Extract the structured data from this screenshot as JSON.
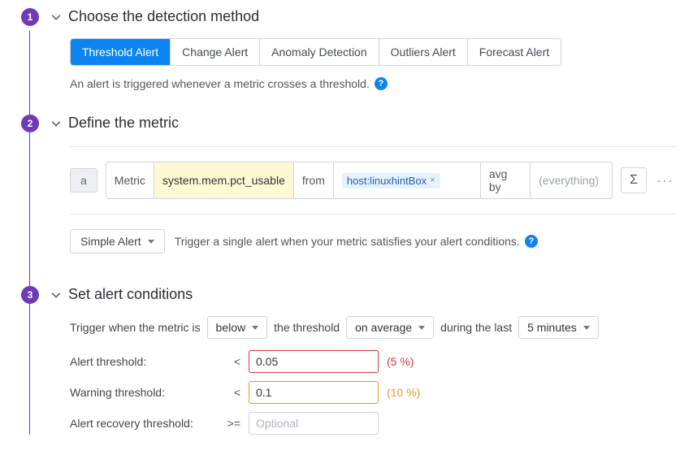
{
  "step1": {
    "num": "1",
    "title": "Choose the detection method",
    "tabs": [
      "Threshold Alert",
      "Change Alert",
      "Anomaly Detection",
      "Outliers Alert",
      "Forecast Alert"
    ],
    "activeTab": 0,
    "desc": "An alert is triggered whenever a metric crosses a threshold.",
    "helpGlyph": "?"
  },
  "step2": {
    "num": "2",
    "title": "Define the metric",
    "rowLabel": "a",
    "metricLabel": "Metric",
    "metricValue": "system.mem.pct_usable",
    "fromLabel": "from",
    "fromTag": "host:linuxhintBox",
    "avgLabel": "avg by",
    "everythingPlaceholder": "(everything)",
    "sigma": "Σ",
    "dots": "···",
    "alertType": "Simple Alert",
    "alertTypeDesc": "Trigger a single alert when your metric satisfies your alert conditions.",
    "helpGlyph": "?"
  },
  "step3": {
    "num": "3",
    "title": "Set alert conditions",
    "sent": {
      "pre": "Trigger when the metric is",
      "comp": "below",
      "mid1": "the threshold",
      "agg": "on average",
      "mid2": "during the last",
      "window": "5 minutes"
    },
    "alertThreshold": {
      "label": "Alert threshold:",
      "op": "<",
      "value": "0.05",
      "pct": "(5 %)"
    },
    "warnThreshold": {
      "label": "Warning threshold:",
      "op": "<",
      "value": "0.1",
      "pct": "(10 %)"
    },
    "recoveryThreshold": {
      "label": "Alert recovery threshold:",
      "op": ">=",
      "placeholder": "Optional"
    }
  }
}
